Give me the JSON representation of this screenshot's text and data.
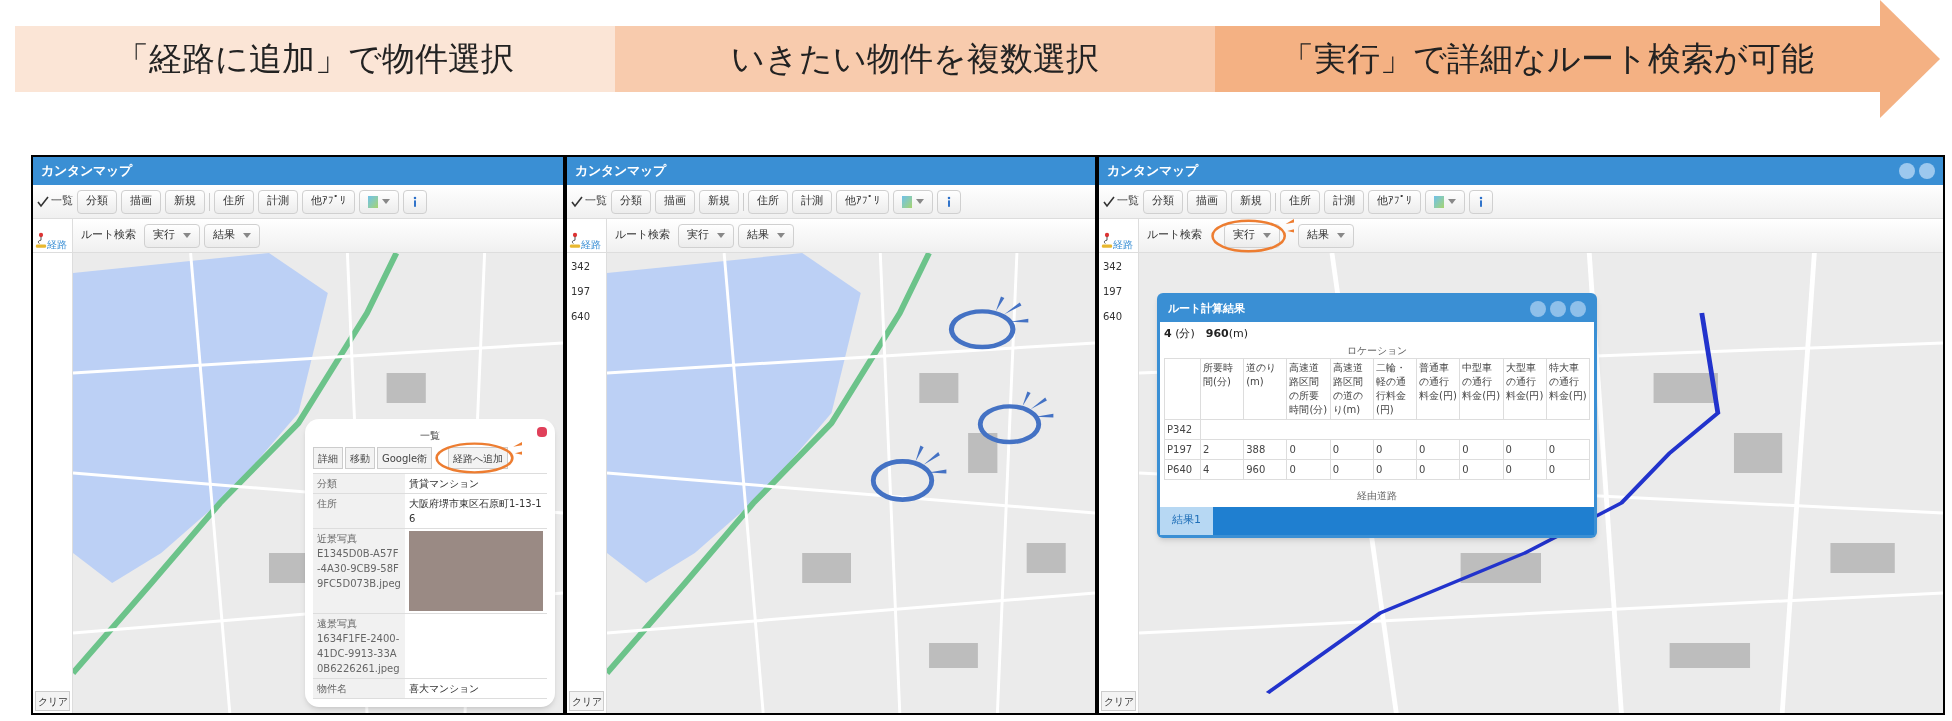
{
  "banner": {
    "steps": [
      {
        "label": "「経路に追加」で物件選択",
        "color": "#fbe5d6"
      },
      {
        "label": "いきたい物件を複数選択",
        "color": "#f8cbad"
      },
      {
        "label": "「実行」で詳細なルート検索が可能",
        "color": "#f4b183"
      }
    ]
  },
  "panels": [
    {
      "kind": "property_popup",
      "title": "カンタンマップ",
      "window_controls": false,
      "list_toggle": {
        "label": "一覧",
        "checked": true
      },
      "buttons": [
        "分類",
        "描画",
        "新規",
        "住所",
        "計測",
        "他ｱﾌﾟﾘ"
      ],
      "route_bar": {
        "icon_label": "経路",
        "label": "ルート検索",
        "menus": [
          "実行",
          "結果"
        ]
      },
      "clear_button": "クリア",
      "highlights": [
        {
          "color": "#ed7d31"
        }
      ],
      "popup": {
        "title": "一覧",
        "buttons": [
          "詳細",
          "移動",
          "Google衛",
          "経路へ追加"
        ],
        "rows": [
          {
            "kind": "text",
            "label": "分類",
            "value": "賃貸マンション"
          },
          {
            "kind": "text",
            "label": "住所",
            "value": "大阪府堺市東区石原町1-13-16"
          },
          {
            "kind": "photo",
            "label": "近景写真",
            "file": "E1345D0B-A57F-4A30-9CB9-58F9FC5D073B.jpeg",
            "photo_shown": true
          },
          {
            "kind": "photo",
            "label": "遠景写真",
            "file": "1634F1FE-2400-41DC-9913-33A0B6226261.jpeg",
            "photo_shown": false
          },
          {
            "kind": "text",
            "label": "物件名",
            "value": "喜大マンション"
          }
        ]
      }
    },
    {
      "kind": "plain",
      "title": "カンタンマップ",
      "window_controls": false,
      "list_toggle": {
        "label": "一覧",
        "checked": true
      },
      "buttons": [
        "分類",
        "描画",
        "新規",
        "住所",
        "計測",
        "他ｱﾌﾟﾘ"
      ],
      "route_bar": {
        "icon_label": "経路",
        "label": "ルート検索",
        "menus": [
          "実行",
          "結果"
        ]
      },
      "side_list": [
        "342",
        "197",
        "640"
      ],
      "clear_button": "クリア",
      "highlights": [
        {
          "color": "#4472c4"
        },
        {
          "color": "#4472c4"
        },
        {
          "color": "#4472c4"
        }
      ]
    },
    {
      "kind": "route_result",
      "title": "カンタンマップ",
      "window_controls": true,
      "list_toggle": {
        "label": "一覧",
        "checked": true
      },
      "buttons": [
        "分類",
        "描画",
        "新規",
        "住所",
        "計測",
        "他ｱﾌﾟﾘ"
      ],
      "route_bar": {
        "icon_label": "経路",
        "label": "ルート検索",
        "menus": [
          "実行",
          "結果"
        ]
      },
      "side_list": [
        "342",
        "197",
        "640"
      ],
      "clear_button": "クリア",
      "highlights": [
        {
          "color": "#ed7d31"
        }
      ],
      "result": {
        "title": "ルート計算結果",
        "summary": "**4** (分)　**960**(m)",
        "section": "ロケーション",
        "columns": [
          "所要時間(分)",
          "道のり(m)",
          "高速道路区間の所要時間(分)",
          "高速道路区間の道のり(m)",
          "二輪・軽の通行料金(円)",
          "普通車の通行料金(円)",
          "中型車の通行料金(円)",
          "大型車の通行料金(円)",
          "特大車の通行料金(円)"
        ],
        "rows": [
          {
            "name": "P342"
          },
          {
            "name": "P197",
            "cells": [
              "2",
              "388",
              "0",
              "0",
              "0",
              "0",
              "0",
              "0",
              "0"
            ]
          },
          {
            "name": "P640",
            "cells": [
              "4",
              "960",
              "0",
              "0",
              "0",
              "0",
              "0",
              "0",
              "0"
            ]
          }
        ],
        "section_2": "経由道路",
        "tabs": [
          {
            "label": "結果1",
            "selected": true
          }
        ]
      }
    }
  ]
}
